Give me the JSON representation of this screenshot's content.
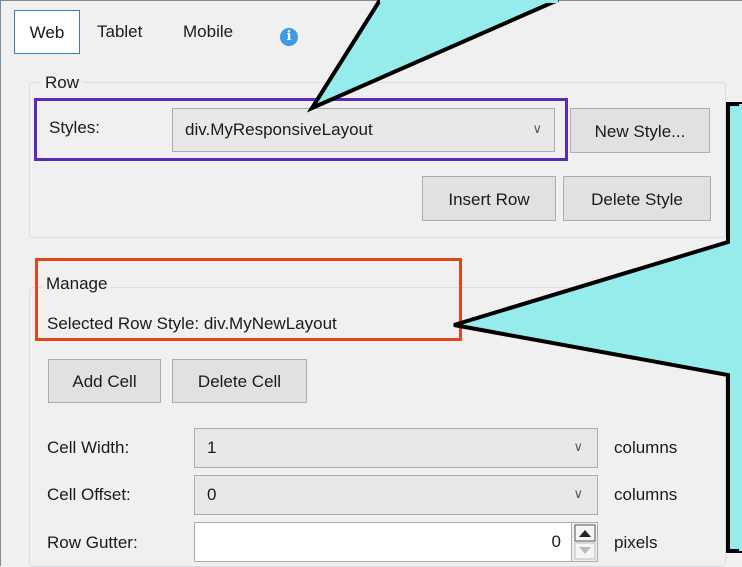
{
  "tabs": [
    {
      "label": "Web"
    },
    {
      "label": "Tablet"
    },
    {
      "label": "Mobile"
    }
  ],
  "info_icon": "info-icon",
  "row_group": {
    "legend": "Row",
    "styles_label": "Styles:",
    "styles_value": "div.MyResponsiveLayout",
    "new_style_label": "New Style...",
    "insert_row_label": "Insert Row",
    "delete_style_label": "Delete Style"
  },
  "manage_group": {
    "legend": "Manage",
    "selected_text": "Selected Row Style: div.MyNewLayout",
    "add_cell_label": "Add Cell",
    "delete_cell_label": "Delete Cell",
    "cell_width_label": "Cell Width:",
    "cell_width_value": "1",
    "cell_width_unit": "columns",
    "cell_offset_label": "Cell Offset:",
    "cell_offset_value": "0",
    "cell_offset_unit": "columns",
    "row_gutter_label": "Row Gutter:",
    "row_gutter_value": "0",
    "row_gutter_unit": "pixels"
  },
  "colors": {
    "callout_fill": "#96ecea",
    "callout_stroke": "#000000",
    "purple_highlight": "#5b2ab8",
    "red_highlight": "#e0461e",
    "accent": "#3e9ae4"
  }
}
